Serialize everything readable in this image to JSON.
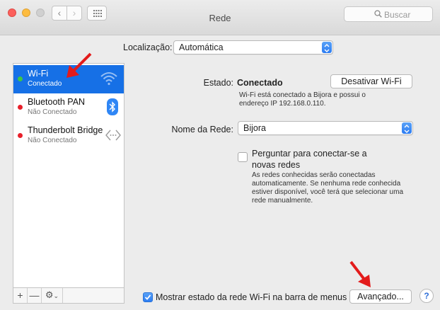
{
  "window": {
    "title": "Rede"
  },
  "toolbar": {
    "back_icon": "chevron-left-icon",
    "forward_icon": "chevron-right-icon",
    "grid_icon": "show-all-grid-icon",
    "search_placeholder": "Buscar"
  },
  "location": {
    "label": "Localização:",
    "value": "Automática"
  },
  "sidebar": {
    "services": [
      {
        "name": "Wi-Fi",
        "status": "Conectado",
        "status_color": "#3ec645",
        "icon": "wifi-icon",
        "selected": true
      },
      {
        "name": "Bluetooth PAN",
        "status": "Não Conectado",
        "status_color": "#e8202b",
        "icon": "bluetooth-icon",
        "selected": false
      },
      {
        "name": "Thunderbolt Bridge",
        "status": "Não Conectado",
        "status_color": "#e8202b",
        "icon": "thunderbolt-bridge-icon",
        "selected": false
      }
    ],
    "buttons": {
      "add": "+",
      "remove": "—",
      "gear": "⚙"
    }
  },
  "detail": {
    "state_label": "Estado:",
    "state_value": "Conectado",
    "toggle_button": "Desativar Wi-Fi",
    "state_desc_1": "Wi-Fi está conectado a Bijora e possui o",
    "state_desc_2": "endereço IP 192.168.0.110.",
    "network_label": "Nome da Rede:",
    "network_value": "Bijora",
    "ask_join_label_1": "Perguntar para conectar-se a",
    "ask_join_label_2": "novas redes",
    "ask_join_checked": false,
    "ask_join_desc": [
      "As redes conhecidas serão conectadas",
      "automaticamente. Se nenhuma rede conhecida",
      "estiver disponível, você terá que selecionar uma",
      "rede manualmente."
    ],
    "show_status_label": "Mostrar estado da rede Wi-Fi na barra de menus",
    "show_status_checked": true,
    "advanced_button": "Avançado...",
    "help_button": "?"
  },
  "colors": {
    "accent": "#1670e6",
    "annotation_arrow": "#e31b1b"
  }
}
